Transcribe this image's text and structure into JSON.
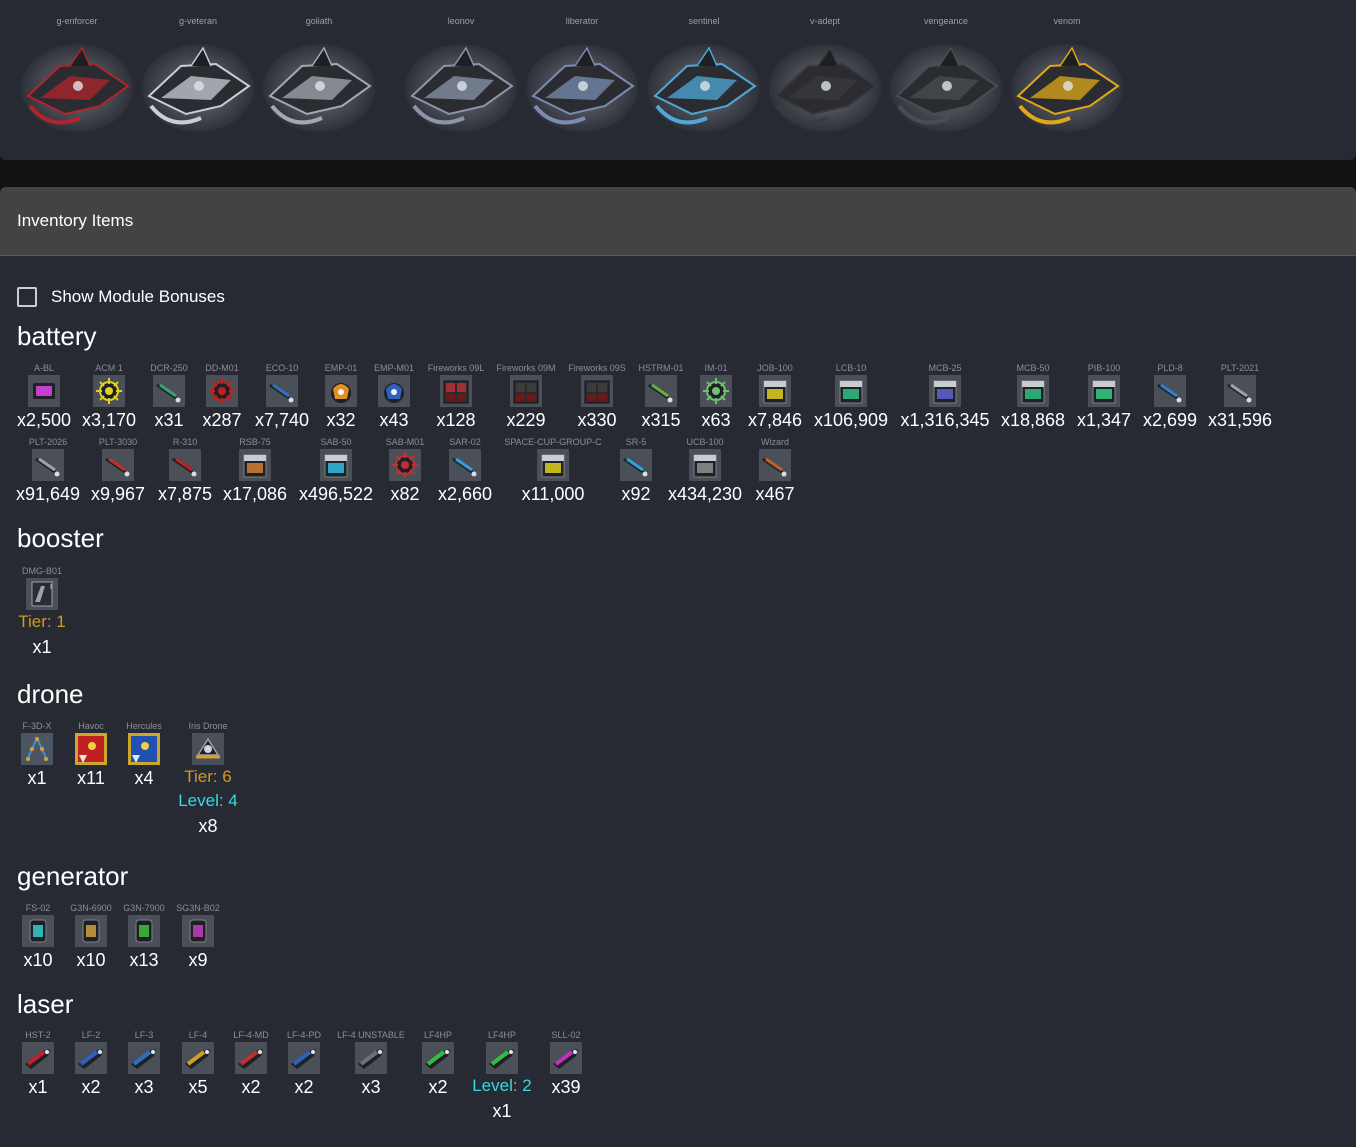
{
  "ships": [
    {
      "name": "g-enforcer",
      "icon": "g-enforcer-ship-icon",
      "color": "#b0242a"
    },
    {
      "name": "g-veteran",
      "icon": "g-veteran-ship-icon",
      "color": "#c9ced6"
    },
    {
      "name": "goliath",
      "icon": "goliath-ship-icon",
      "color": "#a4a8b0"
    },
    {
      "name": "leonov",
      "icon": "leonov-ship-icon",
      "color": "#8b96aa"
    },
    {
      "name": "liberator",
      "icon": "liberator-ship-icon",
      "color": "#7a8cb0"
    },
    {
      "name": "sentinel",
      "icon": "sentinel-ship-icon",
      "color": "#4fa8d8"
    },
    {
      "name": "v-adept",
      "icon": "v-adept-ship-icon",
      "color": "#3a3a3c"
    },
    {
      "name": "vengeance",
      "icon": "vengeance-ship-icon",
      "color": "#4a4c50"
    },
    {
      "name": "venom",
      "icon": "venom-ship-icon",
      "color": "#e0a818"
    }
  ],
  "inventory": {
    "title": "Inventory Items",
    "show_bonuses_label": "Show Module Bonuses",
    "categories": [
      {
        "title": "battery",
        "items": [
          {
            "name": "A-BL",
            "count": "x2,500",
            "color": "#c040d0",
            "icon": "battery-icon"
          },
          {
            "name": "ACM 1",
            "count": "x3,170",
            "color": "#e0d020",
            "icon": "mine-icon"
          },
          {
            "name": "DCR-250",
            "count": "x31",
            "color": "#3aa070",
            "icon": "rocket-icon"
          },
          {
            "name": "DD-M01",
            "count": "x287",
            "color": "#c02020",
            "icon": "mine-icon"
          },
          {
            "name": "ECO-10",
            "count": "x7,740",
            "color": "#3070c0",
            "icon": "rocket-icon"
          },
          {
            "name": "EMP-01",
            "count": "x32",
            "color": "#e09020",
            "icon": "emp-icon"
          },
          {
            "name": "EMP-M01",
            "count": "x43",
            "color": "#3060c0",
            "icon": "emp-icon"
          },
          {
            "name": "Fireworks 09L",
            "count": "x128",
            "color": "#c03030",
            "icon": "fireworks-box-icon"
          },
          {
            "name": "Fireworks 09M",
            "count": "x229",
            "color": "#404040",
            "icon": "fireworks-box-icon"
          },
          {
            "name": "Fireworks 09S",
            "count": "x330",
            "color": "#404040",
            "icon": "fireworks-box-icon"
          },
          {
            "name": "HSTRM-01",
            "count": "x315",
            "color": "#60b040",
            "icon": "rocket-icon"
          },
          {
            "name": "IM-01",
            "count": "x63",
            "color": "#70c070",
            "icon": "mine-icon"
          },
          {
            "name": "JOB-100",
            "count": "x7,846",
            "color": "#e0d020",
            "icon": "ammo-box-icon"
          },
          {
            "name": "LCB-10",
            "count": "x106,909",
            "color": "#30c080",
            "icon": "ammo-box-icon"
          },
          {
            "name": "MCB-25",
            "count": "x1,316,345",
            "color": "#6060d0",
            "icon": "ammo-box-icon"
          },
          {
            "name": "MCB-50",
            "count": "x18,868",
            "color": "#30c080",
            "icon": "ammo-box-icon"
          },
          {
            "name": "PIB-100",
            "count": "x1,347",
            "color": "#30d080",
            "icon": "ammo-box-icon"
          },
          {
            "name": "PLD-8",
            "count": "x2,699",
            "color": "#3080d0",
            "icon": "rocket-icon"
          },
          {
            "name": "PLT-2021",
            "count": "x31,596",
            "color": "#a0a0a0",
            "icon": "rocket-icon"
          },
          {
            "name": "PLT-2026",
            "count": "x91,649",
            "color": "#a0a0a0",
            "icon": "rocket-icon"
          },
          {
            "name": "PLT-3030",
            "count": "x9,967",
            "color": "#c03030",
            "icon": "rocket-icon"
          },
          {
            "name": "R-310",
            "count": "x7,875",
            "color": "#c02020",
            "icon": "rocket-icon"
          },
          {
            "name": "RSB-75",
            "count": "x17,086",
            "color": "#d08030",
            "icon": "ammo-box-icon"
          },
          {
            "name": "SAB-50",
            "count": "x496,522",
            "color": "#30c0e0",
            "icon": "ammo-box-icon"
          },
          {
            "name": "SAB-M01",
            "count": "x82",
            "color": "#c03030",
            "icon": "mine-icon"
          },
          {
            "name": "SAR-02",
            "count": "x2,660",
            "color": "#30a0e0",
            "icon": "rocket-icon"
          },
          {
            "name": "SPACE-CUP-GROUP-C",
            "count": "x11,000",
            "color": "#e0d020",
            "icon": "ammo-box-icon"
          },
          {
            "name": "SR-5",
            "count": "x92",
            "color": "#30a0e0",
            "icon": "rocket-icon"
          },
          {
            "name": "UCB-100",
            "count": "x434,230",
            "color": "#909090",
            "icon": "ammo-box-icon"
          },
          {
            "name": "Wizard",
            "count": "x467",
            "color": "#c06030",
            "icon": "rocket-icon"
          }
        ]
      },
      {
        "title": "booster",
        "items": [
          {
            "name": "DMG-B01",
            "count": "x1",
            "tier": "Tier: 1",
            "color": "#a0a0b0",
            "icon": "booster-icon"
          }
        ]
      },
      {
        "title": "drone",
        "items": [
          {
            "name": "F-3D-X",
            "count": "x1",
            "color": "#4090d0",
            "icon": "drone-formation-icon"
          },
          {
            "name": "Havoc",
            "count": "x11",
            "color": "#c02020",
            "icon": "drone-design-icon"
          },
          {
            "name": "Hercules",
            "count": "x4",
            "color": "#2050b0",
            "icon": "drone-design-icon"
          },
          {
            "name": "Iris Drone",
            "count": "x8",
            "tier": "Tier: 6",
            "level": "Level: 4",
            "color": "#a0a0a0",
            "icon": "drone-icon"
          }
        ]
      },
      {
        "title": "generator",
        "items": [
          {
            "name": "FS-02",
            "count": "x10",
            "color": "#30d0d0",
            "icon": "generator-icon"
          },
          {
            "name": "G3N-6900",
            "count": "x10",
            "color": "#d0a040",
            "icon": "generator-icon"
          },
          {
            "name": "G3N-7900",
            "count": "x13",
            "color": "#40c040",
            "icon": "generator-icon"
          },
          {
            "name": "SG3N-B02",
            "count": "x9",
            "color": "#c040c0",
            "icon": "generator-icon"
          }
        ]
      },
      {
        "title": "laser",
        "items": [
          {
            "name": "HST-2",
            "count": "x1",
            "color": "#c02030",
            "icon": "laser-icon"
          },
          {
            "name": "LF-2",
            "count": "x2",
            "color": "#3060c0",
            "icon": "laser-icon"
          },
          {
            "name": "LF-3",
            "count": "x3",
            "color": "#3070c0",
            "icon": "laser-icon"
          },
          {
            "name": "LF-4",
            "count": "x5",
            "color": "#d0a020",
            "icon": "laser-icon"
          },
          {
            "name": "LF-4-MD",
            "count": "x2",
            "color": "#c03030",
            "icon": "laser-icon"
          },
          {
            "name": "LF-4-PD",
            "count": "x2",
            "color": "#3060c0",
            "icon": "laser-icon"
          },
          {
            "name": "LF-4 UNSTABLE",
            "count": "x3",
            "color": "#707070",
            "icon": "laser-icon"
          },
          {
            "name": "LF4HP",
            "count": "x2",
            "color": "#30c040",
            "icon": "laser-icon"
          },
          {
            "name": "LF4HP",
            "count": "x1",
            "level": "Level: 2",
            "color": "#30c040",
            "icon": "laser-icon"
          },
          {
            "name": "SLL-02",
            "count": "x39",
            "color": "#c030c0",
            "icon": "laser-icon"
          }
        ]
      }
    ]
  }
}
